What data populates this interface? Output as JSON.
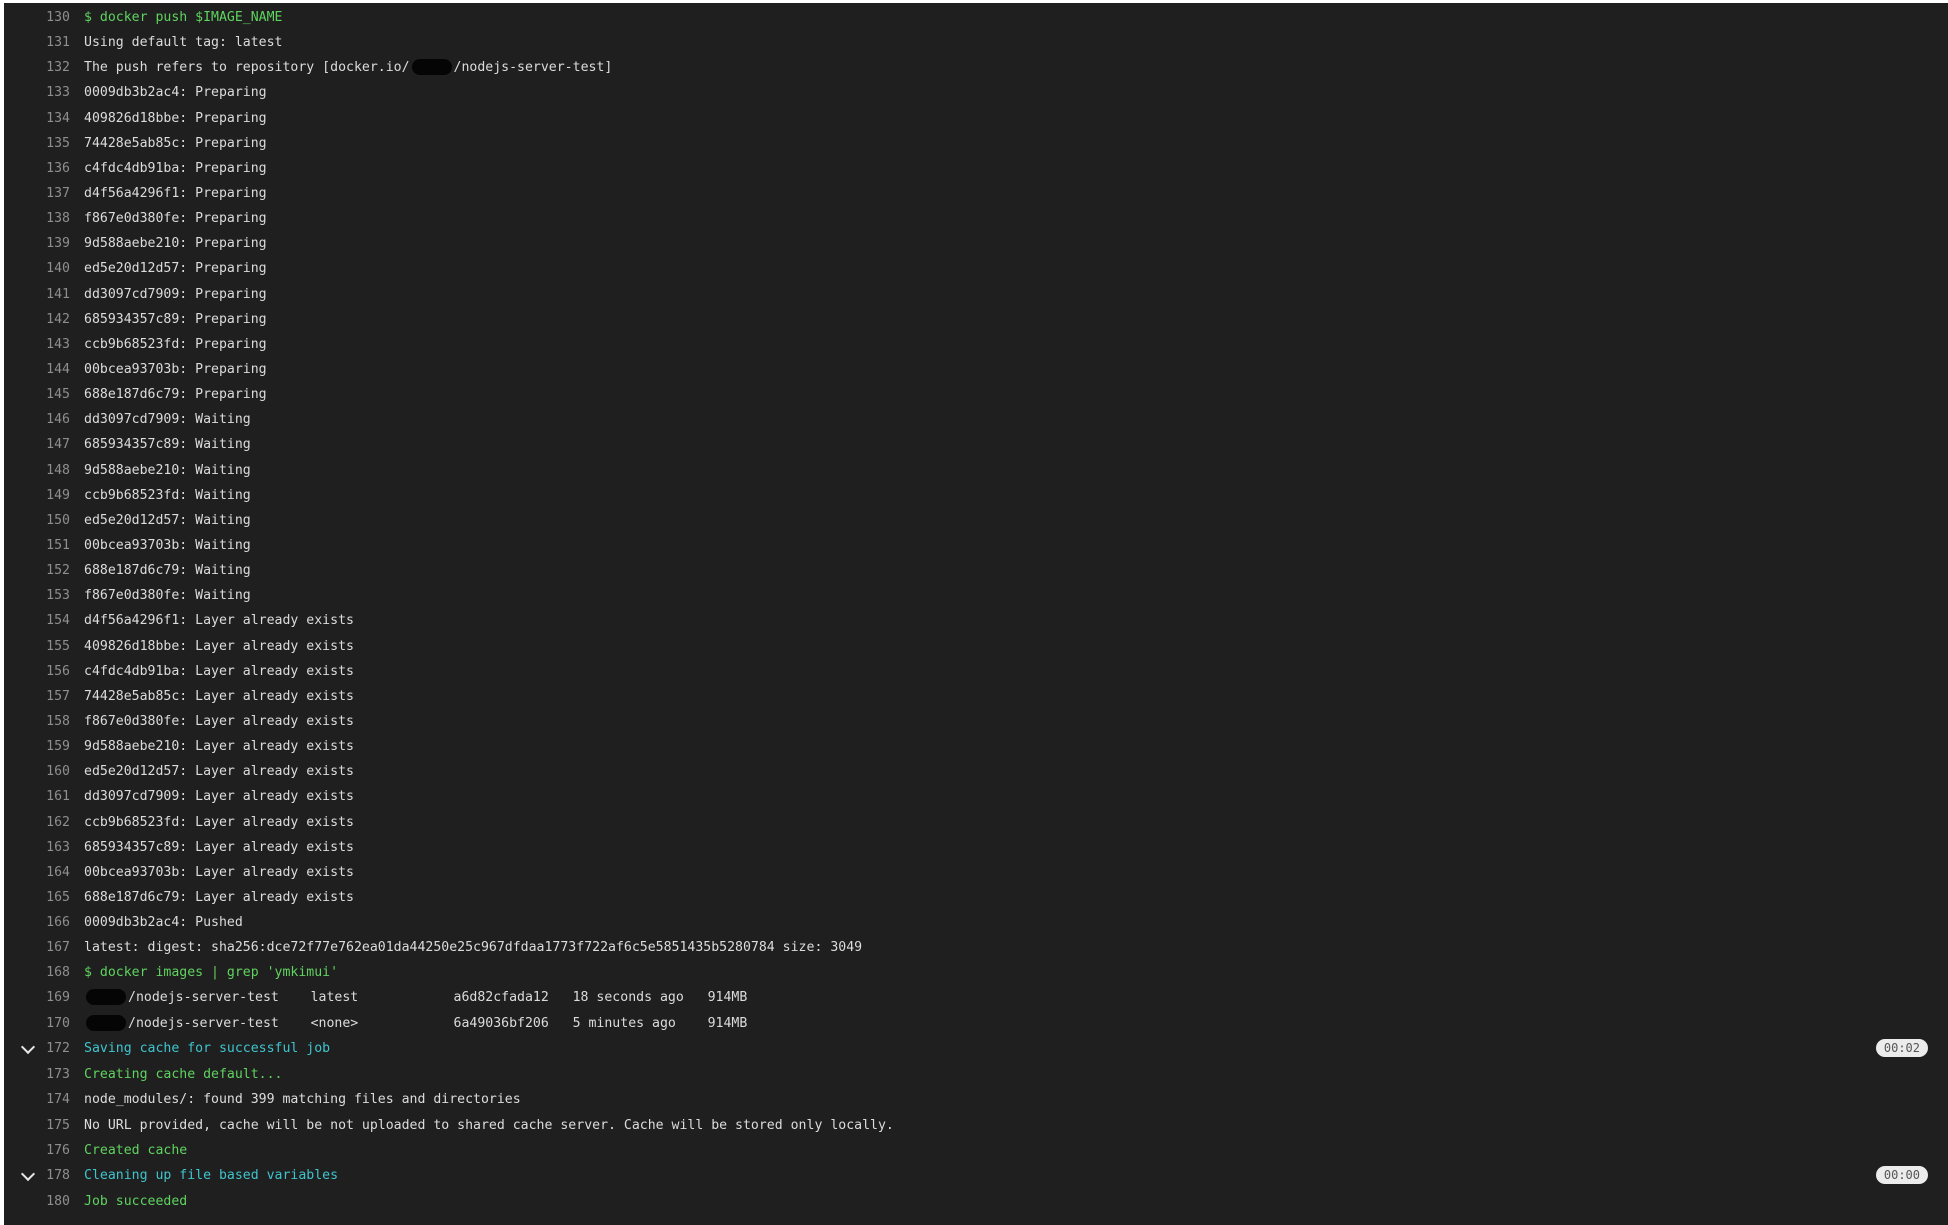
{
  "lines": [
    {
      "n": "130",
      "text": "$ docker push $IMAGE_NAME",
      "kind": "cmd"
    },
    {
      "n": "131",
      "text": "Using default tag: latest"
    },
    {
      "n": "132",
      "pre": "The push refers to repository [docker.io/",
      "post": "/nodejs-server-test]",
      "redacted": true
    },
    {
      "n": "133",
      "text": "0009db3b2ac4: Preparing"
    },
    {
      "n": "134",
      "text": "409826d18bbe: Preparing"
    },
    {
      "n": "135",
      "text": "74428e5ab85c: Preparing"
    },
    {
      "n": "136",
      "text": "c4fdc4db91ba: Preparing"
    },
    {
      "n": "137",
      "text": "d4f56a4296f1: Preparing"
    },
    {
      "n": "138",
      "text": "f867e0d380fe: Preparing"
    },
    {
      "n": "139",
      "text": "9d588aebe210: Preparing"
    },
    {
      "n": "140",
      "text": "ed5e20d12d57: Preparing"
    },
    {
      "n": "141",
      "text": "dd3097cd7909: Preparing"
    },
    {
      "n": "142",
      "text": "685934357c89: Preparing"
    },
    {
      "n": "143",
      "text": "ccb9b68523fd: Preparing"
    },
    {
      "n": "144",
      "text": "00bcea93703b: Preparing"
    },
    {
      "n": "145",
      "text": "688e187d6c79: Preparing"
    },
    {
      "n": "146",
      "text": "dd3097cd7909: Waiting"
    },
    {
      "n": "147",
      "text": "685934357c89: Waiting"
    },
    {
      "n": "148",
      "text": "9d588aebe210: Waiting"
    },
    {
      "n": "149",
      "text": "ccb9b68523fd: Waiting"
    },
    {
      "n": "150",
      "text": "ed5e20d12d57: Waiting"
    },
    {
      "n": "151",
      "text": "00bcea93703b: Waiting"
    },
    {
      "n": "152",
      "text": "688e187d6c79: Waiting"
    },
    {
      "n": "153",
      "text": "f867e0d380fe: Waiting"
    },
    {
      "n": "154",
      "text": "d4f56a4296f1: Layer already exists"
    },
    {
      "n": "155",
      "text": "409826d18bbe: Layer already exists"
    },
    {
      "n": "156",
      "text": "c4fdc4db91ba: Layer already exists"
    },
    {
      "n": "157",
      "text": "74428e5ab85c: Layer already exists"
    },
    {
      "n": "158",
      "text": "f867e0d380fe: Layer already exists"
    },
    {
      "n": "159",
      "text": "9d588aebe210: Layer already exists"
    },
    {
      "n": "160",
      "text": "ed5e20d12d57: Layer already exists"
    },
    {
      "n": "161",
      "text": "dd3097cd7909: Layer already exists"
    },
    {
      "n": "162",
      "text": "ccb9b68523fd: Layer already exists"
    },
    {
      "n": "163",
      "text": "685934357c89: Layer already exists"
    },
    {
      "n": "164",
      "text": "00bcea93703b: Layer already exists"
    },
    {
      "n": "165",
      "text": "688e187d6c79: Layer already exists"
    },
    {
      "n": "166",
      "text": "0009db3b2ac4: Pushed"
    },
    {
      "n": "167",
      "text": "latest: digest: sha256:dce72f77e762ea01da44250e25c967dfdaa1773f722af6c5e5851435b5280784 size: 3049"
    },
    {
      "n": "168",
      "text": "$ docker images | grep 'ymkimui'",
      "kind": "cmd"
    },
    {
      "n": "169",
      "pre": "",
      "post": "/nodejs-server-test    latest            a6d82cfada12   18 seconds ago   914MB",
      "redacted": true
    },
    {
      "n": "170",
      "pre": "",
      "post": "/nodejs-server-test    <none>            6a49036bf206   5 minutes ago    914MB",
      "redacted": true
    },
    {
      "n": "172",
      "text": "Saving cache for successful job",
      "kind": "section",
      "duration": "00:02"
    },
    {
      "n": "173",
      "text": "Creating cache default...",
      "kind": "ok"
    },
    {
      "n": "174",
      "text": "node_modules/: found 399 matching files and directories"
    },
    {
      "n": "175",
      "text": "No URL provided, cache will be not uploaded to shared cache server. Cache will be stored only locally."
    },
    {
      "n": "176",
      "text": "Created cache",
      "kind": "ok"
    },
    {
      "n": "178",
      "text": "Cleaning up file based variables",
      "kind": "section",
      "duration": "00:00"
    },
    {
      "n": "180",
      "text": "Job succeeded",
      "kind": "ok"
    }
  ],
  "colors": {
    "background": "#1f1f1f",
    "text": "#dcdcdc",
    "command": "#5fd35f",
    "section": "#3fc4ce",
    "line_number": "#8e8e8e"
  },
  "icons": {
    "section_toggle": "chevron-down-icon"
  }
}
